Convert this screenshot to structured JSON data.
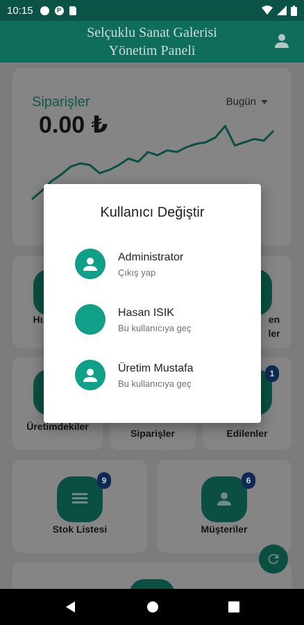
{
  "status_bar": {
    "time": "10:15"
  },
  "app_bar": {
    "title_line1": "Selçuklu Sanat Galerisi",
    "title_line2": "Yönetim Paneli"
  },
  "orders": {
    "title": "Siparişler",
    "total": "0.00 ₺",
    "period": "Bugün"
  },
  "chart_data": {
    "type": "line",
    "values": [
      30,
      40,
      52,
      60,
      70,
      74,
      72,
      62,
      66,
      72,
      80,
      76,
      88,
      84,
      90,
      88,
      94,
      98,
      100,
      106,
      120,
      96,
      100,
      104,
      102,
      114
    ],
    "ylim": [
      0,
      140
    ],
    "color": "#0b4f43"
  },
  "tiles": {
    "row1": {
      "left_label_line1": "Hız",
      "left_label_line2": "O",
      "right_label_line1": "en",
      "right_label_line2": "ler"
    },
    "row2": {
      "left_label": "Üretimdekiler",
      "mid_label": "Siparişler",
      "right_label": "Edilenler",
      "right_badge": "1"
    },
    "row3": {
      "left_label": "Stok Listesi",
      "left_badge": "9",
      "right_label": "Müşteriler",
      "right_badge": "6"
    }
  },
  "dialog": {
    "title": "Kullanıcı Değiştir",
    "users": [
      {
        "name": "Administrator",
        "sub": "Çıkış yap",
        "has_icon": true
      },
      {
        "name": "Hasan ISIK",
        "sub": "Bu kullanıcıya geç",
        "has_icon": false
      },
      {
        "name": "Üretim Mustafa",
        "sub": "Bu kullanıcıya geç",
        "has_icon": true
      }
    ]
  },
  "colors": {
    "primary": "#10a08a",
    "app_bar": "#0f6d5d",
    "badge": "#0e2a52"
  }
}
